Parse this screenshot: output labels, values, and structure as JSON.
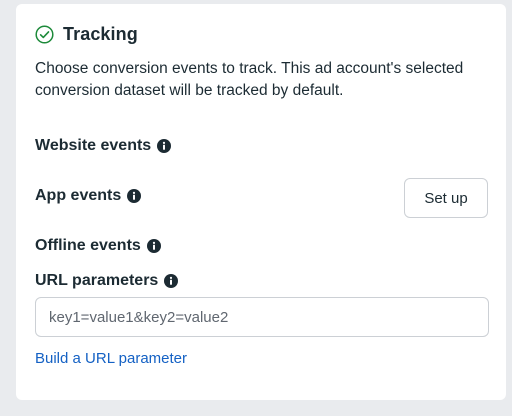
{
  "section": {
    "title": "Tracking",
    "description": "Choose conversion events to track. This ad account's selected conversion dataset will be tracked by default."
  },
  "website_events": {
    "label": "Website events",
    "icon": "info-icon"
  },
  "app_events": {
    "label": "App events",
    "icon": "info-icon",
    "button_label": "Set up"
  },
  "offline_events": {
    "label": "Offline events",
    "icon": "info-icon"
  },
  "url_parameters": {
    "label": "URL parameters",
    "icon": "info-icon",
    "placeholder": "key1=value1&key2=value2",
    "value": ""
  },
  "build_link": {
    "label": "Build a URL parameter"
  },
  "colors": {
    "accent": "#1461c4",
    "success": "#1d8a3a",
    "text": "#1c2b33"
  }
}
